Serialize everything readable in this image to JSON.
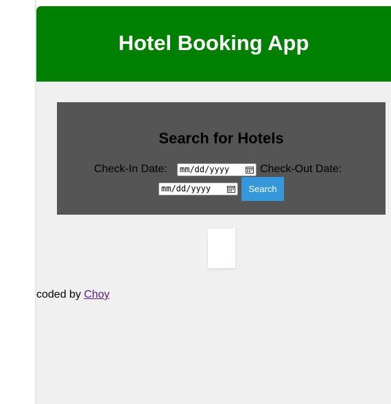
{
  "header": {
    "title": "Hotel Booking App",
    "bg_color": "#008000"
  },
  "search": {
    "heading": "Search for Hotels",
    "checkin_label": "Check-In Date:",
    "checkin_placeholder": "mm/dd/yyyy",
    "checkout_label": "Check-Out Date:",
    "checkout_placeholder": "mm/dd/yyyy",
    "button_label": "Search",
    "button_color": "#3498db",
    "panel_color": "#555555"
  },
  "footer": {
    "prefix": "coded by",
    "link_text": "Choy"
  },
  "icons": {
    "date_picker": "calendar-icon"
  }
}
